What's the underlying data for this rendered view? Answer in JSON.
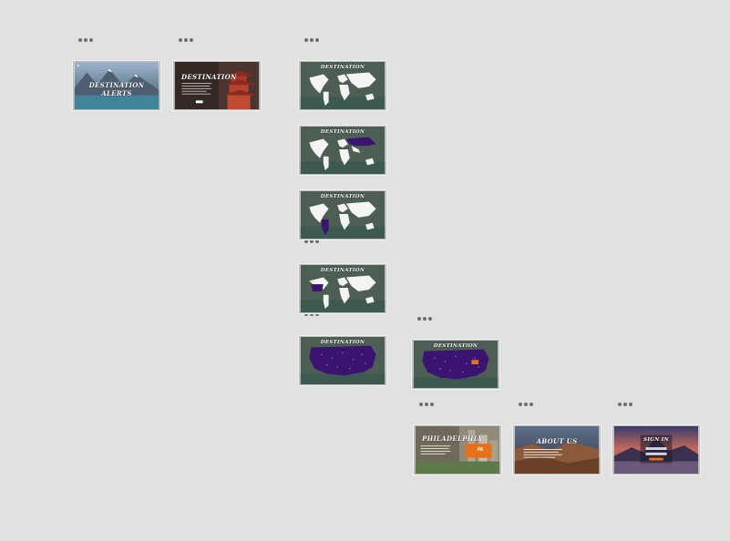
{
  "canvas": {
    "background": "#e1e1e1"
  },
  "colors": {
    "purple": "#3b1370",
    "orange": "#e8701a",
    "dots": "#6d6d6d"
  },
  "icons": {
    "menu": "more-dots-icon"
  },
  "artboards": [
    {
      "id": "destination-alerts",
      "title": "DESTINATION ALERTS"
    },
    {
      "id": "destination",
      "title": "DESTINATION"
    },
    {
      "id": "map-1",
      "title": "DESTINATION"
    },
    {
      "id": "map-2",
      "title": "DESTINATION"
    },
    {
      "id": "map-3",
      "title": "DESTINATION"
    },
    {
      "id": "map-4",
      "title": "DESTINATION"
    },
    {
      "id": "usa-map-1",
      "title": "DESTINATION"
    },
    {
      "id": "usa-map-2",
      "title": "DESTINATION",
      "badge": ""
    },
    {
      "id": "philadelphia",
      "title": "PHILADELPHIA",
      "badge": "PA"
    },
    {
      "id": "about-us",
      "title": "ABOUT US"
    },
    {
      "id": "sign-in",
      "title": "SIGN IN"
    }
  ]
}
